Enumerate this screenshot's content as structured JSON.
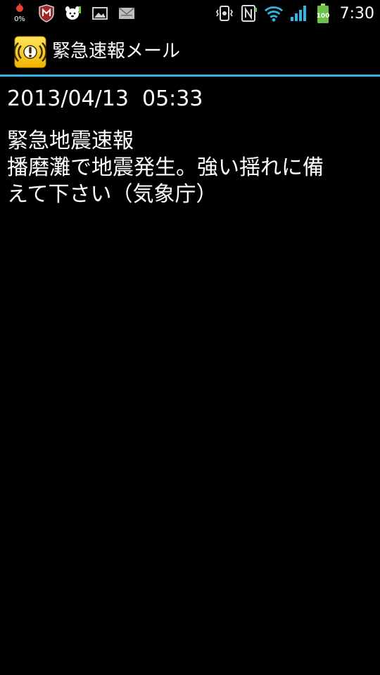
{
  "status_bar": {
    "left_icons": [
      {
        "name": "battery-mix-icon",
        "label": "0%"
      },
      {
        "name": "mcafee-shield-icon"
      },
      {
        "name": "dog-app-icon"
      },
      {
        "name": "image-icon"
      },
      {
        "name": "mail-icon"
      }
    ],
    "right_icons": [
      {
        "name": "vibrate-icon"
      },
      {
        "name": "nfc-icon"
      },
      {
        "name": "wifi-icon"
      },
      {
        "name": "signal-icon"
      },
      {
        "name": "battery-icon",
        "label": "100"
      }
    ],
    "time": "7:30"
  },
  "header": {
    "app_icon": "emergency-alert-icon",
    "title": "緊急速報メール"
  },
  "message": {
    "datetime": "2013/04/13  05:33",
    "subject": "緊急地震速報",
    "body_lines": [
      "播磨灘で地震発生。強い揺れに備",
      "えて下さい（気象庁）"
    ]
  },
  "colors": {
    "background": "#000000",
    "accent_divider": "#33b5e5",
    "text": "#ffffff",
    "app_icon_yellow": "#f5c400"
  }
}
